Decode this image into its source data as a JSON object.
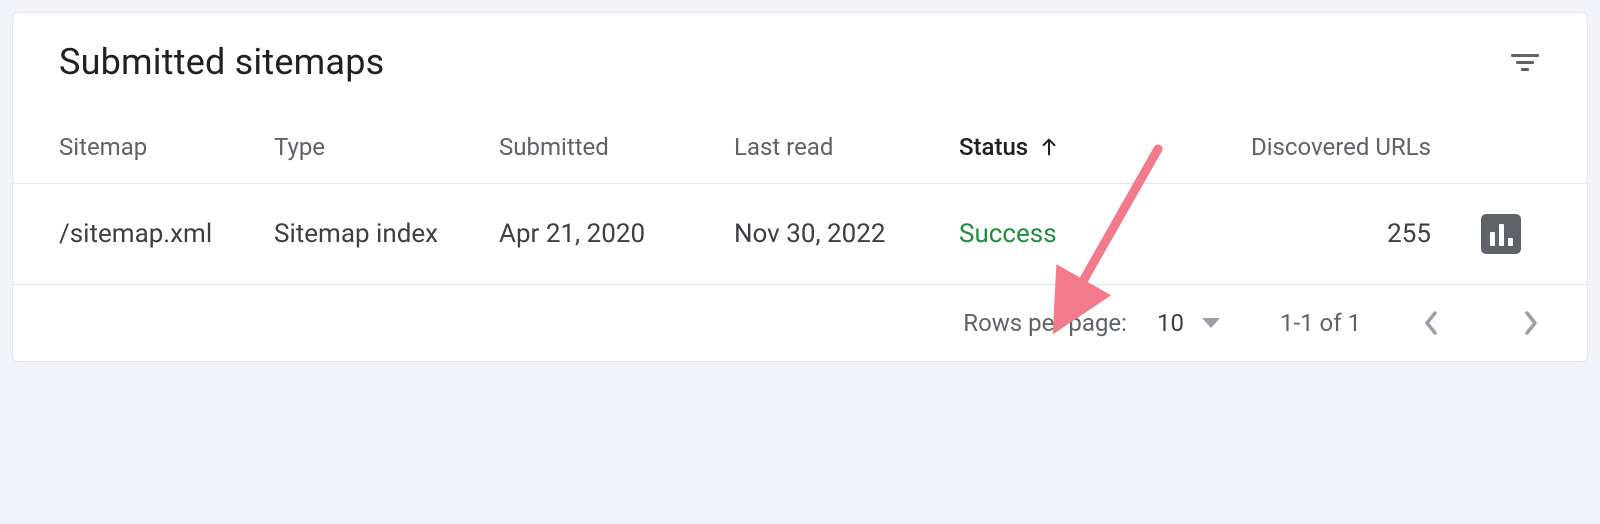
{
  "header": {
    "title": "Submitted sitemaps"
  },
  "table": {
    "columns": {
      "sitemap": "Sitemap",
      "type": "Type",
      "submitted": "Submitted",
      "last_read": "Last read",
      "status": "Status",
      "discovered": "Discovered URLs"
    },
    "rows": [
      {
        "sitemap": "/sitemap.xml",
        "type": "Sitemap index",
        "submitted": "Apr 21, 2020",
        "last_read": "Nov 30, 2022",
        "status": "Success",
        "discovered": "255"
      }
    ]
  },
  "pagination": {
    "rows_label": "Rows per page:",
    "rows_value": "10",
    "range": "1-1 of 1"
  }
}
